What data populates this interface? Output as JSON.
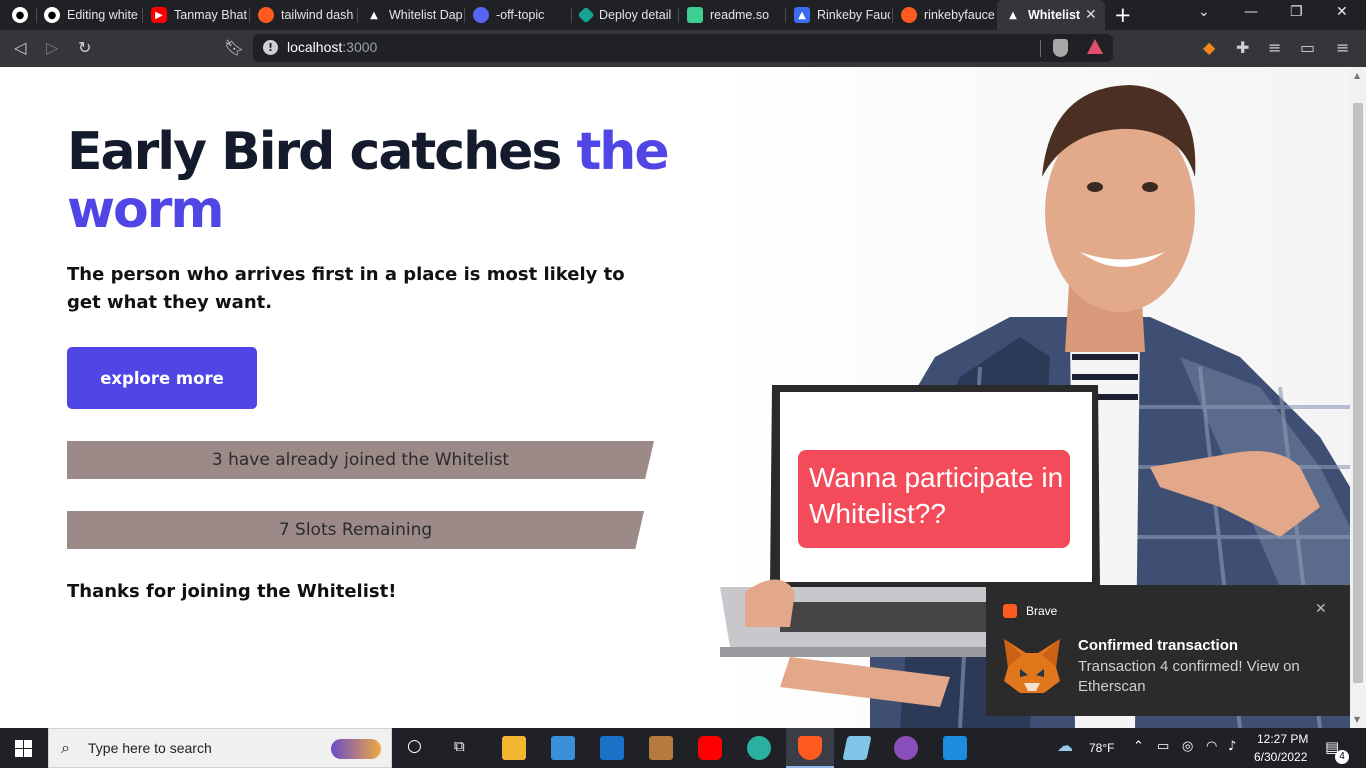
{
  "browser": {
    "tabs": [
      {
        "label": "",
        "color": "#ffffff"
      },
      {
        "label": "Editing white",
        "color": "#ffffff"
      },
      {
        "label": "Tanmay Bhat",
        "color": "#ff0000"
      },
      {
        "label": "tailwind dash",
        "color": "#ff5a1f"
      },
      {
        "label": "Whitelist Dap",
        "color": "#ffffff"
      },
      {
        "label": "-off-topic",
        "color": "#5865f2"
      },
      {
        "label": "Deploy detail",
        "color": "#16a394"
      },
      {
        "label": "readme.so",
        "color": "#3ccf91"
      },
      {
        "label": "Rinkeby Fauc",
        "color": "#3d6cf0"
      },
      {
        "label": "rinkebyfauce",
        "color": "#ff5a1f"
      },
      {
        "label": "Whitelist",
        "color": "#ffffff"
      }
    ],
    "new_tab": "+",
    "url_host": "localhost",
    "url_port": ":3000"
  },
  "hero": {
    "title_main": "Early Bird catches ",
    "title_accent": "the worm",
    "description": "The person who arrives first in a place is most likely to get what they want.",
    "button_label": "explore more",
    "joined_text": "3 have already joined the Whitelist",
    "slots_text": "7 Slots Remaining",
    "thanks_text": "Thanks for joining the Whitelist!",
    "laptop_text": "Wanna participate in Whitelist??",
    "accent_color": "#4f46e5"
  },
  "toast": {
    "app": "Brave",
    "title": "Confirmed transaction",
    "body": "Transaction 4 confirmed! View on Etherscan"
  },
  "taskbar": {
    "search_placeholder": "Type here to search",
    "weather": "78°F",
    "time": "12:27 PM",
    "date": "6/30/2022",
    "notification_count": "4"
  }
}
